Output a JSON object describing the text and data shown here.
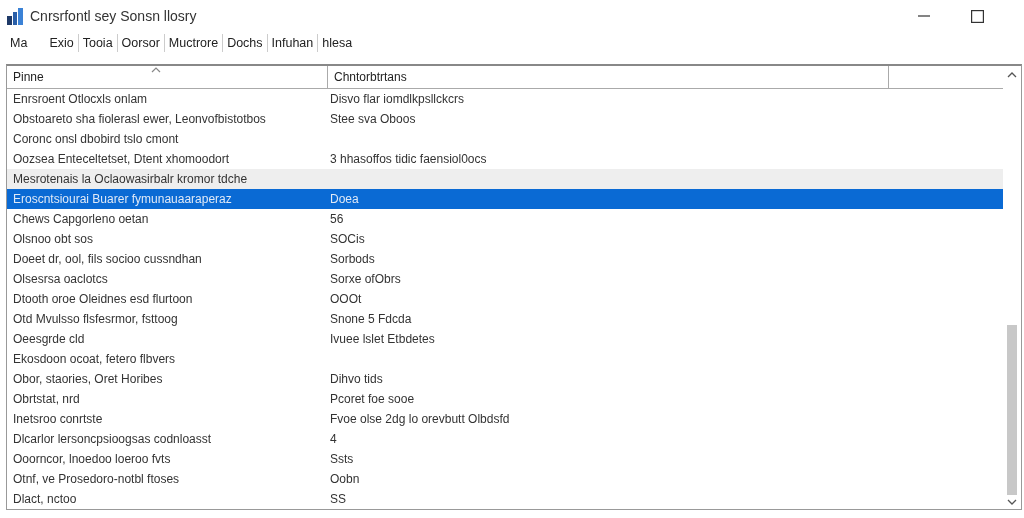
{
  "window": {
    "title": "Cnrsrfontl sey Sonsn llosry"
  },
  "menu": [
    {
      "label": "Ma"
    },
    {
      "label": "Exio"
    },
    {
      "label": "Tooia"
    },
    {
      "label": "Oorsor"
    },
    {
      "label": "Muctrore"
    },
    {
      "label": "Dochs"
    },
    {
      "label": "Infuhan"
    },
    {
      "label": "hlesa"
    }
  ],
  "table": {
    "columns": [
      {
        "label": "Pinne",
        "sorted": true
      },
      {
        "label": "Chntorbtrtans",
        "sorted": false
      }
    ],
    "rows": [
      {
        "cells": [
          "Enrsroent Otlocxls onlam",
          "Disvo flar iomdlkpsllckcrs"
        ],
        "selected": false,
        "hovered": false
      },
      {
        "cells": [
          "Obstoareto sha fiolerasl ewer, Leonvofbistotbos",
          "Stee sva Oboos"
        ],
        "selected": false,
        "hovered": false
      },
      {
        "cells": [
          "Coronc onsl dbobird tslo cmont",
          ""
        ],
        "selected": false,
        "hovered": false
      },
      {
        "cells": [
          "Oozsea Enteceltetset, Dtent xhomoodort",
          "3 hhasoffos tidic faensiol0ocs"
        ],
        "selected": false,
        "hovered": false
      },
      {
        "cells": [
          "Mesrotenais la Oclaowasirbalr kromor tdche",
          ""
        ],
        "selected": false,
        "hovered": true
      },
      {
        "cells": [
          "Eroscntsiourai Buarer fymunauaaraperaz",
          "Doea"
        ],
        "selected": true,
        "hovered": false
      },
      {
        "cells": [
          "Chews Capgorleno oetan",
          "56"
        ],
        "selected": false,
        "hovered": false
      },
      {
        "cells": [
          "Olsnoo obt sos",
          "SOCis"
        ],
        "selected": false,
        "hovered": false
      },
      {
        "cells": [
          "Doeet dr, ool, fils socioo cussndhan",
          "Sorbods"
        ],
        "selected": false,
        "hovered": false
      },
      {
        "cells": [
          "Olsesrsa oaclotcs",
          "Sorxe ofObrs"
        ],
        "selected": false,
        "hovered": false
      },
      {
        "cells": [
          "Dtooth oroe Oleidnes esd flurtoon",
          "OOOt"
        ],
        "selected": false,
        "hovered": false
      },
      {
        "cells": [
          "Otd Mvulsso flsfesrmor, fsttoog",
          "Snone 5 Fdcda"
        ],
        "selected": false,
        "hovered": false
      },
      {
        "cells": [
          "Oeesgrde cld",
          "Ivuee lslet Etbdetes"
        ],
        "selected": false,
        "hovered": false
      },
      {
        "cells": [
          "Ekosdoon ocoat, fetero flbvers",
          ""
        ],
        "selected": false,
        "hovered": false
      },
      {
        "cells": [
          "Obor, staories, Oret Horibes",
          "Dihvo tids"
        ],
        "selected": false,
        "hovered": false
      },
      {
        "cells": [
          "Obrtstat, nrd",
          "Pcoret foe sooe"
        ],
        "selected": false,
        "hovered": false
      },
      {
        "cells": [
          "Inetsroo conrtste",
          "Fvoe olse 2dg lo orevbutt Olbdsfd"
        ],
        "selected": false,
        "hovered": false
      },
      {
        "cells": [
          "Dlcarlor lersoncpsioogsas codnloasst",
          "4"
        ],
        "selected": false,
        "hovered": false
      },
      {
        "cells": [
          "Ooorncor, lnoedoo loeroo fvts",
          "Ssts"
        ],
        "selected": false,
        "hovered": false
      },
      {
        "cells": [
          "Otnf, ve Prosedoro-notbl ftoses",
          "Oobn"
        ],
        "selected": false,
        "hovered": false
      },
      {
        "cells": [
          "Dlact, nctoo",
          "SS"
        ],
        "selected": false,
        "hovered": false
      }
    ]
  }
}
